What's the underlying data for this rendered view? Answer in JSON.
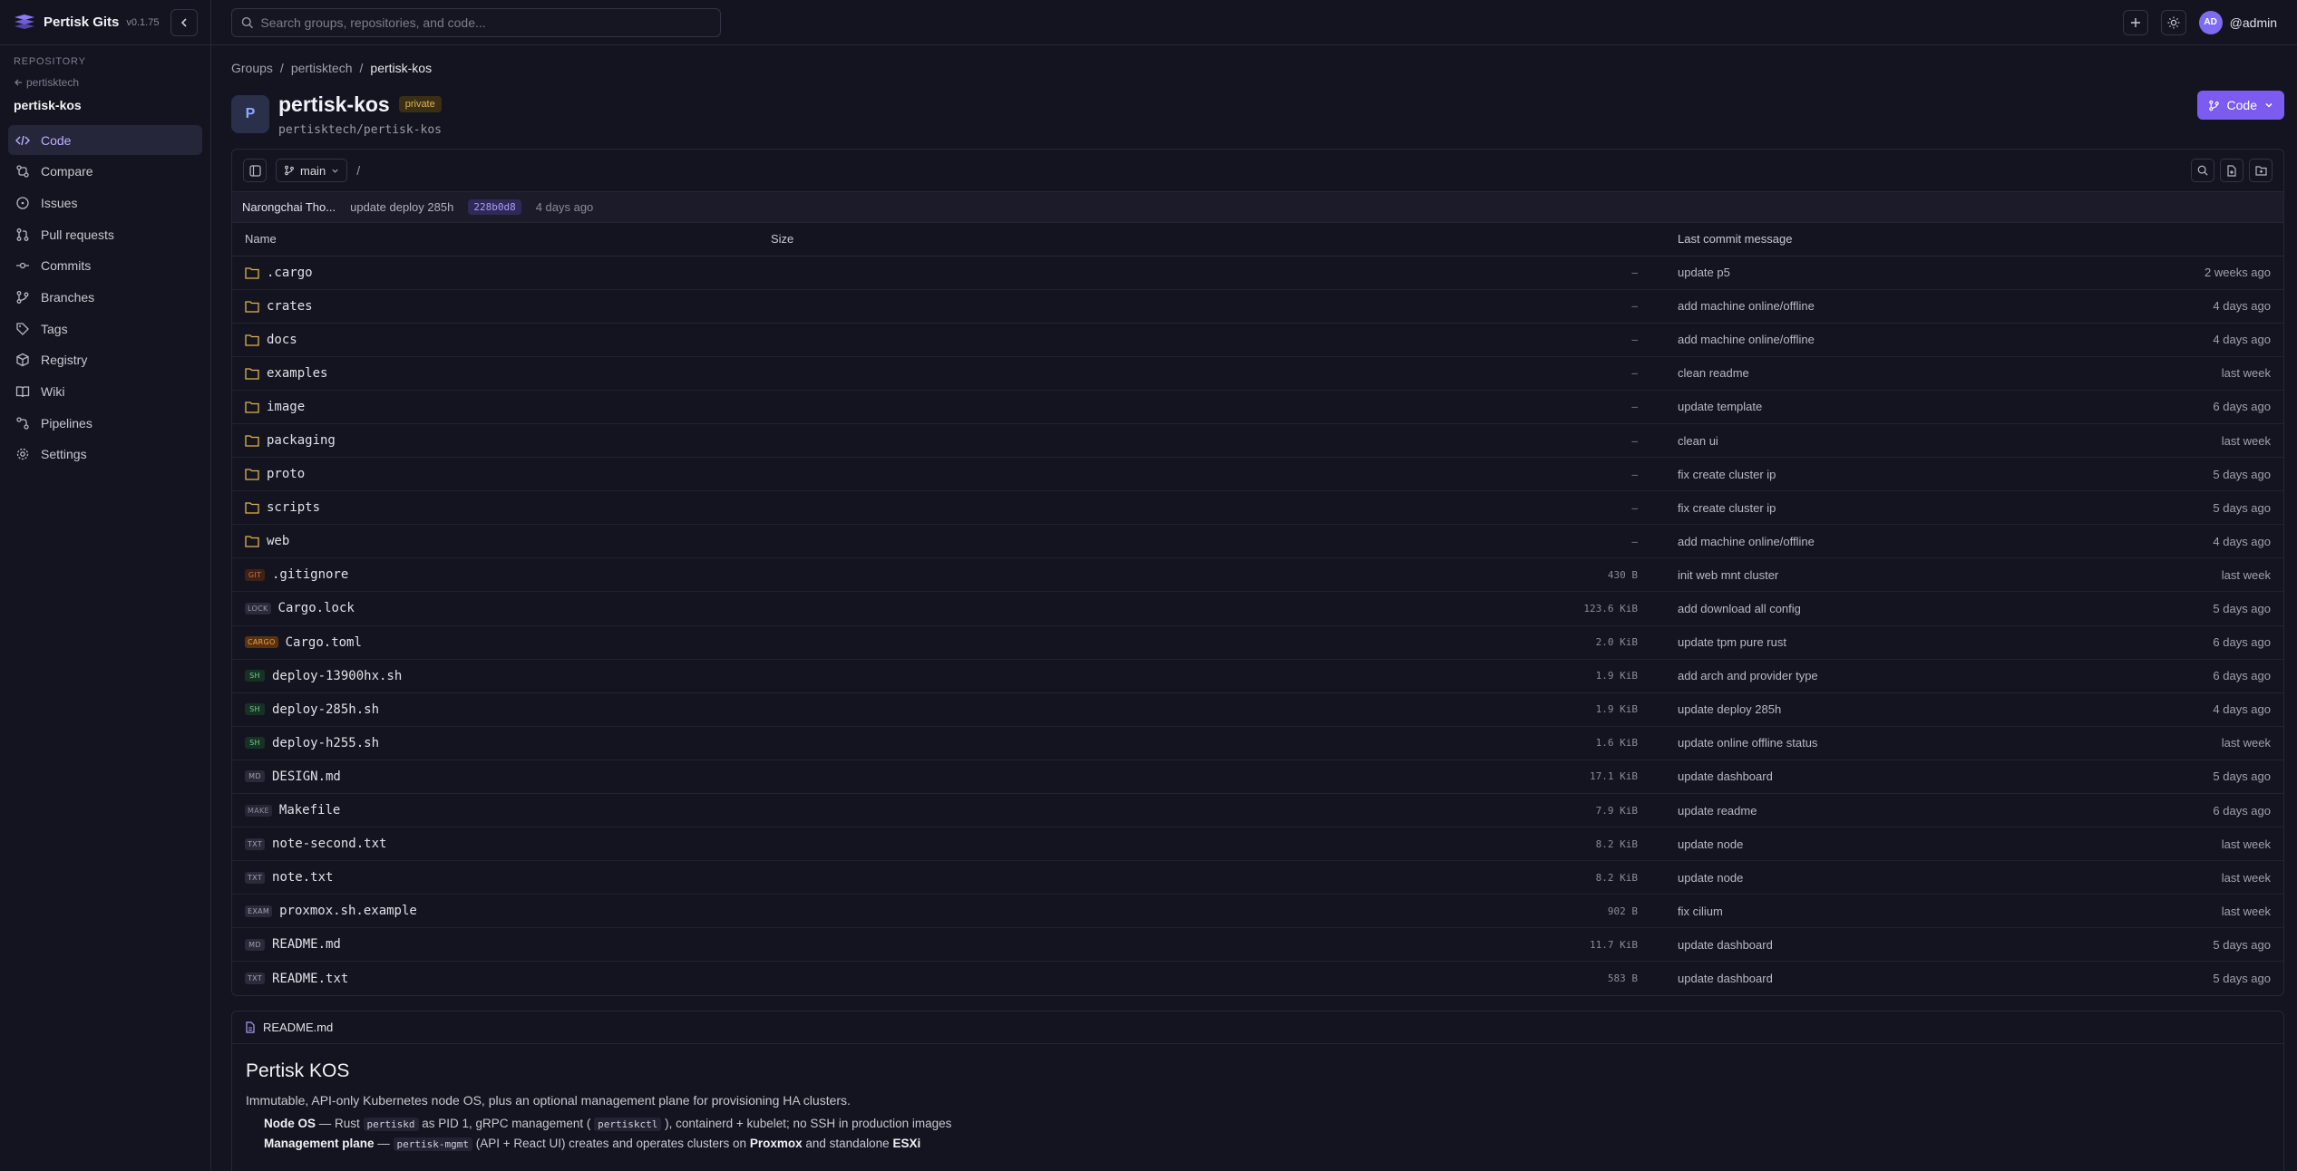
{
  "app": {
    "name": "Pertisk Gits",
    "version": "v0.1.75"
  },
  "sidebar": {
    "section_label": "REPOSITORY",
    "back_label": "pertisktech",
    "repo_name": "pertisk-kos",
    "items": [
      {
        "label": "Code",
        "icon": "code-icon"
      },
      {
        "label": "Compare",
        "icon": "compare-icon"
      },
      {
        "label": "Issues",
        "icon": "issue-icon"
      },
      {
        "label": "Pull requests",
        "icon": "pull-request-icon"
      },
      {
        "label": "Commits",
        "icon": "commit-icon"
      },
      {
        "label": "Branches",
        "icon": "branch-icon"
      },
      {
        "label": "Tags",
        "icon": "tag-icon"
      },
      {
        "label": "Registry",
        "icon": "package-icon"
      },
      {
        "label": "Wiki",
        "icon": "book-icon"
      },
      {
        "label": "Pipelines",
        "icon": "pipeline-icon"
      },
      {
        "label": "Settings",
        "icon": "gear-icon"
      }
    ]
  },
  "topbar": {
    "search_placeholder": "Search groups, repositories, and code...",
    "avatar_initials": "AD",
    "username": "@admin"
  },
  "breadcrumb": [
    "Groups",
    "pertisktech",
    "pertisk-kos"
  ],
  "repo": {
    "avatar_letter": "P",
    "title": "pertisk-kos",
    "visibility": "private",
    "path": "pertisktech/pertisk-kos",
    "code_button": "Code"
  },
  "toolbar": {
    "branch": "main",
    "path": "/"
  },
  "last_commit": {
    "author": "Narongchai Tho...",
    "message": "update deploy 285h",
    "sha": "228b0d8",
    "time": "4 days ago"
  },
  "table": {
    "headers": {
      "name": "Name",
      "size": "Size",
      "message": "Last commit message"
    },
    "rows": [
      {
        "type": "folder",
        "name": ".cargo",
        "size": "–",
        "message": "update p5",
        "time": "2 weeks ago"
      },
      {
        "type": "folder",
        "name": "crates",
        "size": "–",
        "message": "add machine online/offline",
        "time": "4 days ago"
      },
      {
        "type": "folder",
        "name": "docs",
        "size": "–",
        "message": "add machine online/offline",
        "time": "4 days ago"
      },
      {
        "type": "folder",
        "name": "examples",
        "size": "–",
        "message": "clean readme",
        "time": "last week"
      },
      {
        "type": "folder",
        "name": "image",
        "size": "–",
        "message": "update template",
        "time": "6 days ago"
      },
      {
        "type": "folder",
        "name": "packaging",
        "size": "–",
        "message": "clean ui",
        "time": "last week"
      },
      {
        "type": "folder",
        "name": "proto",
        "size": "–",
        "message": "fix create cluster ip",
        "time": "5 days ago"
      },
      {
        "type": "folder",
        "name": "scripts",
        "size": "–",
        "message": "fix create cluster ip",
        "time": "5 days ago"
      },
      {
        "type": "folder",
        "name": "web",
        "size": "–",
        "message": "add machine online/offline",
        "time": "4 days ago"
      },
      {
        "type": "file",
        "tag": "GIT",
        "tag_color": "#e0673a",
        "tag_bg": "#3d2218",
        "name": ".gitignore",
        "size": "430 B",
        "message": "init web mnt cluster",
        "time": "last week"
      },
      {
        "type": "file",
        "tag": "LOCK",
        "tag_color": "#9a9aa8",
        "tag_bg": "#2a2a38",
        "name": "Cargo.lock",
        "size": "123.6 KiB",
        "message": "add download all config",
        "time": "5 days ago"
      },
      {
        "type": "file",
        "tag": "CARGO",
        "tag_color": "#f0a050",
        "tag_bg": "#5a3210",
        "name": "Cargo.toml",
        "size": "2.0 KiB",
        "message": "update tpm pure rust",
        "time": "6 days ago"
      },
      {
        "type": "file",
        "tag": "SH",
        "tag_color": "#6ad08a",
        "tag_bg": "#173224",
        "name": "deploy-13900hx.sh",
        "size": "1.9 KiB",
        "message": "add arch and provider type",
        "time": "6 days ago"
      },
      {
        "type": "file",
        "tag": "SH",
        "tag_color": "#6ad08a",
        "tag_bg": "#173224",
        "name": "deploy-285h.sh",
        "size": "1.9 KiB",
        "message": "update deploy 285h",
        "time": "4 days ago"
      },
      {
        "type": "file",
        "tag": "SH",
        "tag_color": "#6ad08a",
        "tag_bg": "#173224",
        "name": "deploy-h255.sh",
        "size": "1.6 KiB",
        "message": "update online offline status",
        "time": "last week"
      },
      {
        "type": "file",
        "tag": "MD",
        "tag_color": "#a0a0ae",
        "tag_bg": "#2a2a38",
        "name": "DESIGN.md",
        "size": "17.1 KiB",
        "message": "update dashboard",
        "time": "5 days ago"
      },
      {
        "type": "file",
        "tag": "MAKE",
        "tag_color": "#8a8a9a",
        "tag_bg": "#262634",
        "name": "Makefile",
        "size": "7.9 KiB",
        "message": "update readme",
        "time": "6 days ago"
      },
      {
        "type": "file",
        "tag": "TXT",
        "tag_color": "#a0a0ae",
        "tag_bg": "#2a2a38",
        "name": "note-second.txt",
        "size": "8.2 KiB",
        "message": "update node",
        "time": "last week"
      },
      {
        "type": "file",
        "tag": "TXT",
        "tag_color": "#a0a0ae",
        "tag_bg": "#2a2a38",
        "name": "note.txt",
        "size": "8.2 KiB",
        "message": "update node",
        "time": "last week"
      },
      {
        "type": "file",
        "tag": "EXAM",
        "tag_color": "#a0a0ae",
        "tag_bg": "#2a2a38",
        "name": "proxmox.sh.example",
        "size": "902 B",
        "message": "fix cilium",
        "time": "last week"
      },
      {
        "type": "file",
        "tag": "MD",
        "tag_color": "#a0a0ae",
        "tag_bg": "#2a2a38",
        "name": "README.md",
        "size": "11.7 KiB",
        "message": "update dashboard",
        "time": "5 days ago"
      },
      {
        "type": "file",
        "tag": "TXT",
        "tag_color": "#a0a0ae",
        "tag_bg": "#2a2a38",
        "name": "README.txt",
        "size": "583 B",
        "message": "update dashboard",
        "time": "5 days ago"
      }
    ]
  },
  "readme": {
    "filename": "README.md",
    "title": "Pertisk KOS",
    "description": "Immutable, API-only Kubernetes node OS, plus an optional management plane for provisioning HA clusters.",
    "bullet1": {
      "bold": "Node OS",
      "t1": " — Rust ",
      "code1": "pertiskd",
      "t2": " as PID 1, gRPC management ( ",
      "code2": "pertiskctl",
      "t3": " ), containerd + kubelet; no SSH in production images"
    },
    "bullet2": {
      "bold": "Management plane",
      "t1": " — ",
      "code1": "pertisk-mgmt",
      "t2": " (API + React UI) creates and operates clusters on ",
      "bold2": "Proxmox",
      "t3": " and standalone ",
      "bold3": "ESXi"
    }
  },
  "colors": {
    "accent": "#7c5cf0",
    "background": "#141420",
    "border": "#262636"
  }
}
